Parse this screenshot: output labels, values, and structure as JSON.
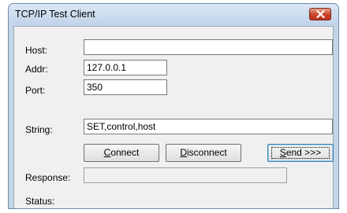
{
  "window": {
    "title": "TCP/IP Test Client"
  },
  "labels": {
    "host": "Host:",
    "addr": "Addr:",
    "port": "Port:",
    "string": "String:",
    "response": "Response:",
    "status": "Status:"
  },
  "fields": {
    "host_value": "",
    "addr_value": "127.0.0.1",
    "port_value": "350",
    "string_value": "SET,control,host",
    "response_value": ""
  },
  "buttons": {
    "connect": {
      "accel": "C",
      "rest": "onnect"
    },
    "disconnect": {
      "accel": "D",
      "rest": "isconnect"
    },
    "send": {
      "accel": "S",
      "rest": "end >>>"
    }
  },
  "colors": {
    "close_button": "#c8432a",
    "frame": "#c4d5e8",
    "client_bg": "#f0f0f0"
  },
  "icons": {
    "close": "close-icon"
  }
}
